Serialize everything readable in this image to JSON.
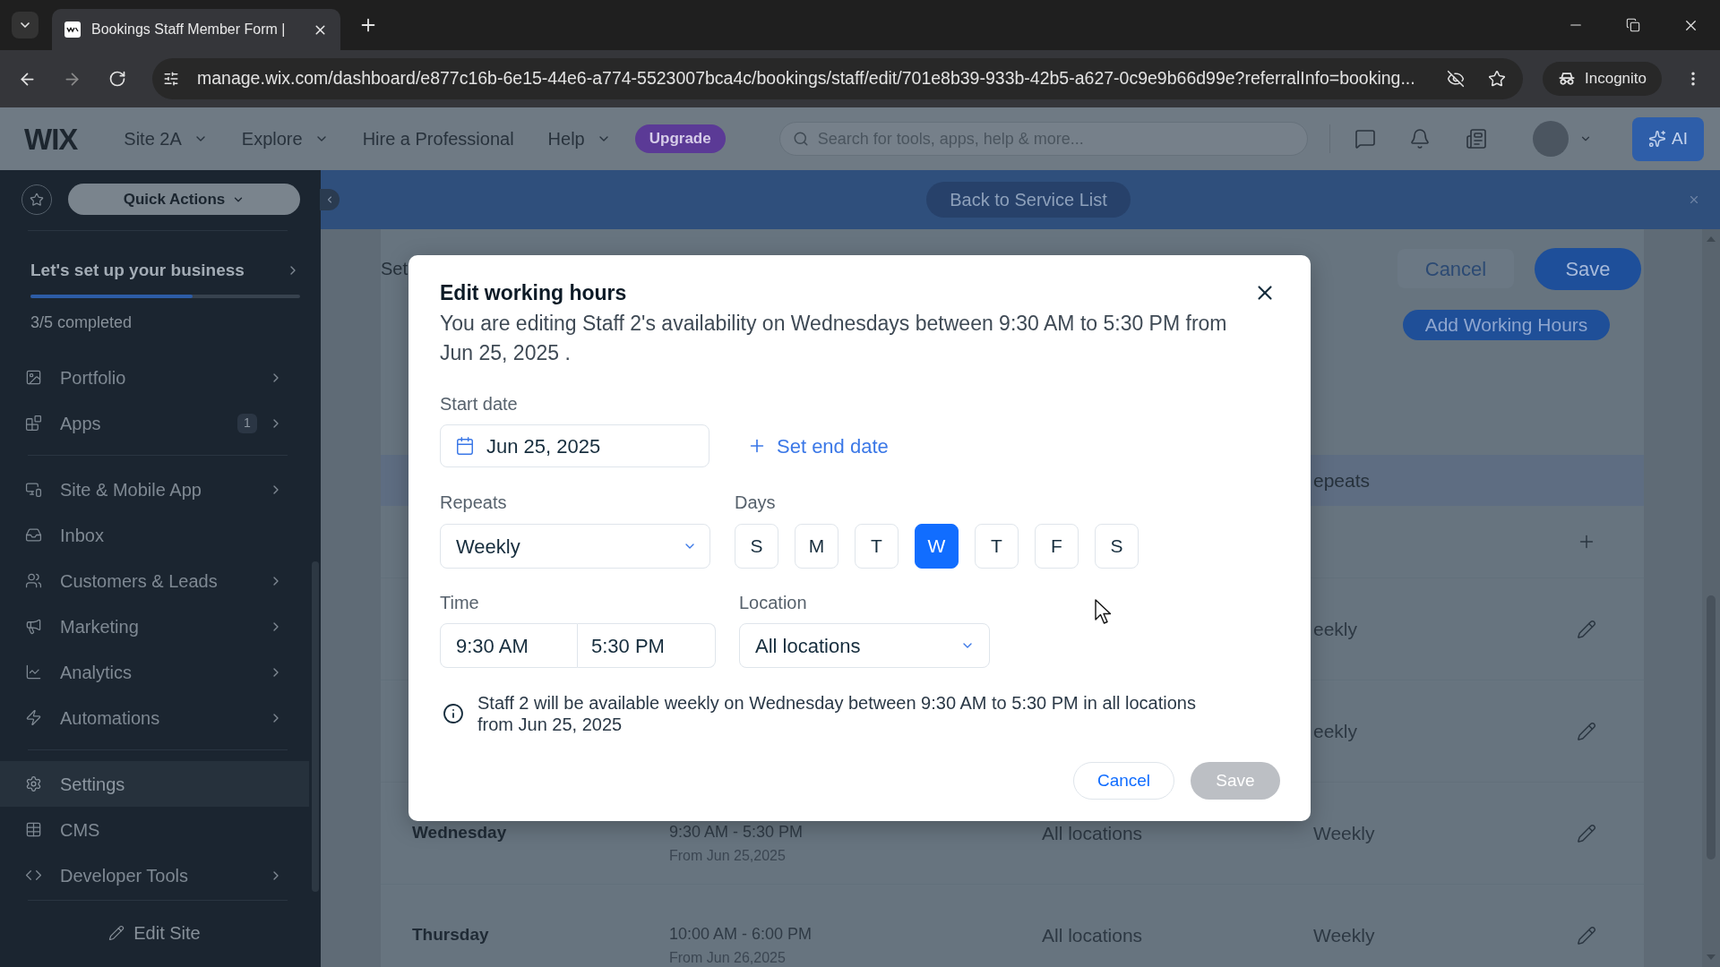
{
  "browser": {
    "tabs": [
      {
        "title": "Bookings Staff Member Form |",
        "selected": true
      }
    ],
    "address": "manage.wix.com/dashboard/e877c16b-6e15-44e6-a774-5523007bca4c/bookings/staff/edit/701e8b39-933b-42b5-a627-0c9e9b66d99e?referralInfo=booking...",
    "profile": "Incognito"
  },
  "header": {
    "logo": "WIX",
    "menus": [
      {
        "label": "Site 2A",
        "dropdown": true
      },
      {
        "label": "Explore",
        "dropdown": true
      },
      {
        "label": "Hire a Professional",
        "dropdown": false
      },
      {
        "label": "Help",
        "dropdown": true
      }
    ],
    "upgrade": "Upgrade",
    "search": {
      "placeholder": "Search for tools, apps, help & more..."
    },
    "ai_button": "AI"
  },
  "sidebar": {
    "quick_actions": "Quick Actions",
    "setup": {
      "title": "Let's set up your business",
      "level": 0.6,
      "progress": "3/5 completed"
    },
    "groups": [
      {
        "items": [
          {
            "label": "Portfolio",
            "expandable": true,
            "selected": false
          },
          {
            "label": "Apps",
            "badge": "1",
            "expandable": true,
            "selected": false
          }
        ]
      },
      {
        "items": [
          {
            "label": "Site & Mobile App",
            "expandable": true,
            "selected": false
          },
          {
            "label": "Inbox",
            "expandable": false,
            "selected": false
          },
          {
            "label": "Customers & Leads",
            "expandable": true,
            "selected": false
          },
          {
            "label": "Marketing",
            "expandable": true,
            "selected": false
          },
          {
            "label": "Analytics",
            "expandable": true,
            "selected": false
          },
          {
            "label": "Automations",
            "expandable": true,
            "selected": false
          }
        ]
      },
      {
        "items": [
          {
            "label": "Settings",
            "expandable": false,
            "selected": true
          },
          {
            "label": "CMS",
            "expandable": false,
            "selected": false
          },
          {
            "label": "Developer Tools",
            "expandable": true,
            "selected": false
          }
        ]
      }
    ],
    "edit_site": "Edit Site"
  },
  "banner": {
    "back_button": "Back to Service List"
  },
  "page": {
    "title": "Set",
    "buttons": [
      {
        "label": "Cancel",
        "kind": "secondary"
      },
      {
        "label": "Save",
        "kind": "primary"
      }
    ],
    "add_button": "Add Working Hours",
    "table": {
      "header": {
        "repeats": "epeats"
      },
      "rows": [
        {
          "kind": "add"
        },
        {
          "kind": "edit",
          "repeats": "eekly"
        },
        {
          "kind": "edit",
          "repeats": "eekly"
        },
        {
          "kind": "edit",
          "day": "Wednesday",
          "time": "9:30 AM - 5:30 PM",
          "from": "From Jun 25,2025",
          "location": "All locations",
          "repeats": "Weekly"
        },
        {
          "kind": "edit",
          "day": "Thursday",
          "time": "10:00 AM - 6:00 PM",
          "from": "From Jun 26,2025",
          "location": "All locations",
          "repeats": "Weekly"
        }
      ]
    }
  },
  "modal": {
    "title": "Edit working hours",
    "description": "You are editing Staff 2's availability on Wednesdays between 9:30 AM to 5:30 PM from Jun 25, 2025 .",
    "start_date": {
      "label": "Start date",
      "value": "Jun 25, 2025"
    },
    "end_date_link": "Set end date",
    "repeats": {
      "label": "Repeats",
      "value": "Weekly"
    },
    "days": {
      "label": "Days",
      "items": [
        {
          "label": "S",
          "selected": false
        },
        {
          "label": "M",
          "selected": false
        },
        {
          "label": "T",
          "selected": false
        },
        {
          "label": "W",
          "selected": true
        },
        {
          "label": "T",
          "selected": false
        },
        {
          "label": "F",
          "selected": false
        },
        {
          "label": "S",
          "selected": false
        }
      ]
    },
    "time": {
      "label": "Time",
      "start": "9:30 AM",
      "end": "5:30 PM"
    },
    "location": {
      "label": "Location",
      "value": "All locations"
    },
    "summary": "Staff 2 will be available weekly on Wednesday between 9:30 AM to 5:30 PM in all locations from Jun 25, 2025",
    "buttons": [
      {
        "label": "Cancel",
        "kind": "secondary",
        "disabled": false
      },
      {
        "label": "Save",
        "kind": "primary",
        "disabled": true
      }
    ]
  }
}
